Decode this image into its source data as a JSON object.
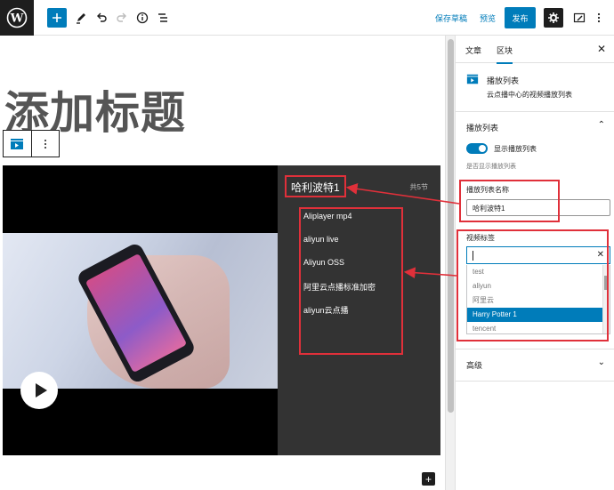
{
  "toolbar": {
    "save_draft": "保存草稿",
    "preview": "预览",
    "publish": "发布"
  },
  "editor": {
    "title": "添加标题"
  },
  "player": {
    "playlist_title": "哈利波特1",
    "count": "共5节",
    "items": [
      "Aliplayer mp4",
      "aliyun live",
      "Aliyun OSS",
      "阿里云点播标准加密",
      "aliyun云点播"
    ]
  },
  "sidebar": {
    "tabs": [
      "文章",
      "区块"
    ],
    "block_name": "播放列表",
    "block_desc": "云点播中心的视频播放列表",
    "panel_playlist": "播放列表",
    "toggle_label": "显示播放列表",
    "help_text": "是否显示播放列表",
    "name_label": "播放列表名称",
    "name_value": "哈利波特1",
    "tag_label": "视频标签",
    "options": [
      "test",
      "aliyun",
      "阿里云",
      "Harry Potter 1",
      "tencent"
    ],
    "panel_advanced": "高级"
  },
  "colors": {
    "accent": "#007cba",
    "annotation": "#e0303a",
    "dark": "#1e1e1e",
    "playlist_bg": "#333333"
  }
}
